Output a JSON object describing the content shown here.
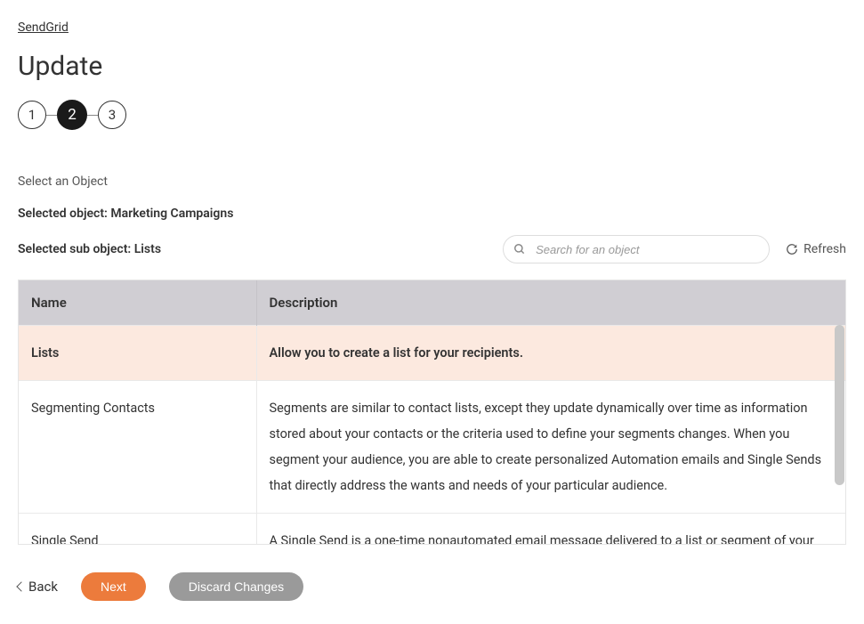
{
  "breadcrumb": "SendGrid",
  "page_title": "Update",
  "stepper": {
    "steps": [
      "1",
      "2",
      "3"
    ],
    "active_index": 1
  },
  "section_label": "Select an Object",
  "selected_object_line": "Selected object: Marketing Campaigns",
  "selected_sub_object_line": "Selected sub object: Lists",
  "search": {
    "placeholder": "Search for an object"
  },
  "refresh_label": "Refresh",
  "table": {
    "headers": {
      "name": "Name",
      "description": "Description"
    },
    "rows": [
      {
        "name": "Lists",
        "description": "Allow you to create a list for your recipients.",
        "selected": true
      },
      {
        "name": "Segmenting Contacts",
        "description": "Segments are similar to contact lists, except they update dynamically over time as information stored about your contacts or the criteria used to define your segments changes. When you segment your audience, you are able to create personalized Automation emails and Single Sends that directly address the wants and needs of your particular audience.",
        "selected": false
      },
      {
        "name": "Single Send",
        "description": "A Single Send is a one-time nonautomated email message delivered to a list or segment of your audience. A Single Send may be sent immediately or scheduled for future delivery. Single Sends",
        "selected": false
      }
    ]
  },
  "footer": {
    "back": "Back",
    "next": "Next",
    "discard": "Discard Changes"
  }
}
